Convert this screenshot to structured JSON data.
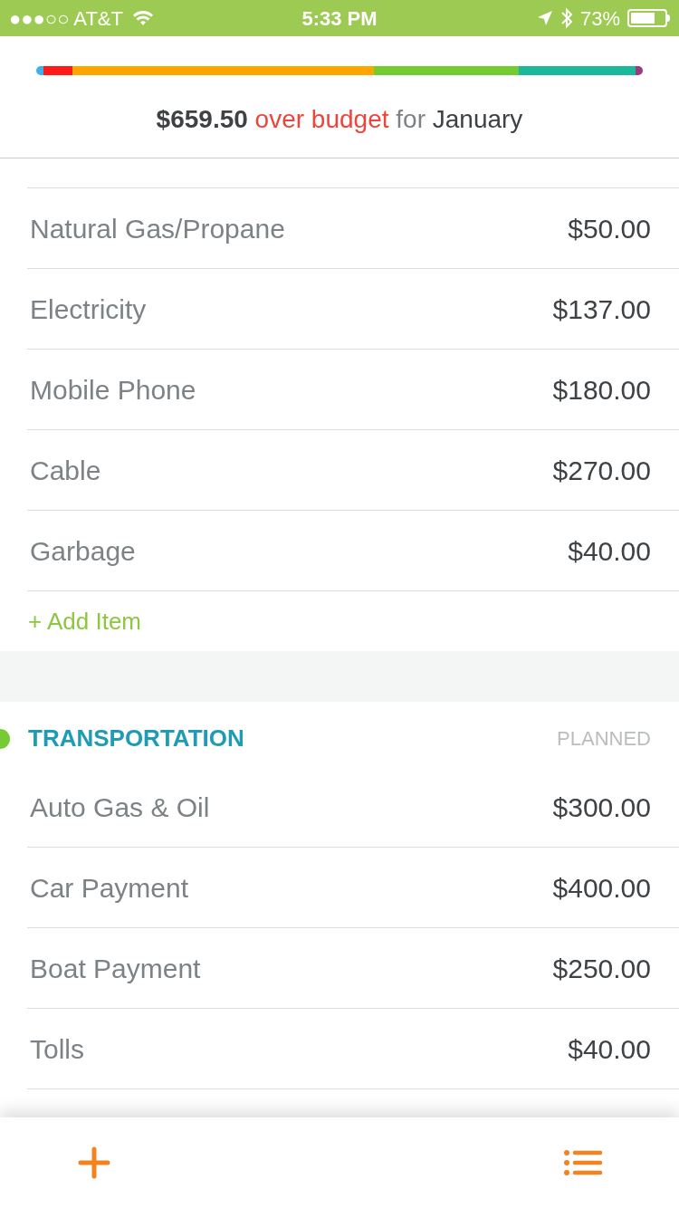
{
  "status_bar": {
    "carrier": "●●●○○ AT&T",
    "time": "5:33 PM",
    "battery": "73%"
  },
  "budget_bar": [
    {
      "color": "#3fb0e8"
    },
    {
      "color": "#ff1a1a"
    },
    {
      "color": "#ffa500"
    },
    {
      "color": "#74cc32"
    },
    {
      "color": "#1cb89a"
    },
    {
      "color": "#9a3b80"
    }
  ],
  "summary": {
    "amount": "$659.50",
    "status": "over budget",
    "connector": "for",
    "month": "January"
  },
  "groups": [
    {
      "items": [
        {
          "name": "Natural Gas/Propane",
          "amount": "$50.00"
        },
        {
          "name": "Electricity",
          "amount": "$137.00"
        },
        {
          "name": "Mobile Phone",
          "amount": "$180.00"
        },
        {
          "name": "Cable",
          "amount": "$270.00"
        },
        {
          "name": "Garbage",
          "amount": "$40.00"
        }
      ],
      "add_label": "+ Add Item"
    },
    {
      "title": "TRANSPORTATION",
      "column": "PLANNED",
      "color": "#74cc32",
      "items": [
        {
          "name": "Auto Gas & Oil",
          "amount": "$300.00"
        },
        {
          "name": "Car Payment",
          "amount": "$400.00"
        },
        {
          "name": "Boat Payment",
          "amount": "$250.00"
        },
        {
          "name": "Tolls",
          "amount": "$40.00"
        }
      ]
    }
  ]
}
